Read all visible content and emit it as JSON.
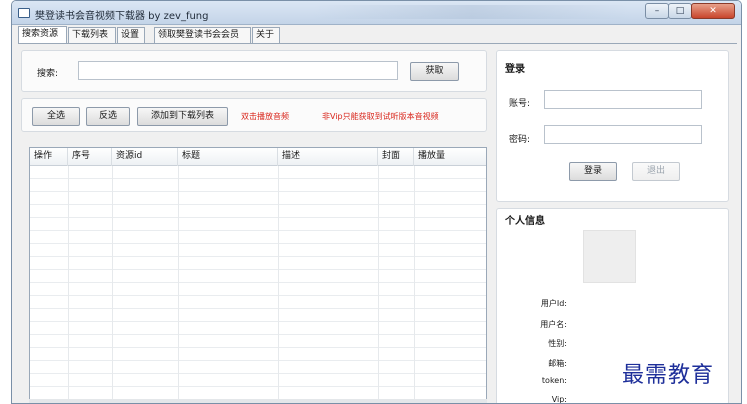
{
  "window": {
    "title": "樊登读书会音视频下载器 by zev_fung",
    "controls": {
      "minimize": "–",
      "maximize": "□",
      "close": "✕"
    }
  },
  "tabs": [
    {
      "label": "搜索资源",
      "active": true
    },
    {
      "label": "下载列表",
      "active": false
    },
    {
      "label": "设置",
      "active": false
    },
    {
      "label": "领取樊登读书会会员",
      "active": false
    },
    {
      "label": "关于",
      "active": false
    }
  ],
  "search": {
    "label": "搜索:",
    "value": "",
    "fetch_button": "获取"
  },
  "actions": {
    "select_all": "全选",
    "invert": "反选",
    "add_to_list": "添加到下载列表",
    "hint_play": "双击播放音频",
    "hint_vip": "非Vip只能获取到试听版本音视频"
  },
  "table": {
    "columns": [
      "操作",
      "序号",
      "资源id",
      "标题",
      "描述",
      "封面",
      "播放量"
    ],
    "rows": []
  },
  "login": {
    "title": "登录",
    "account_label": "账号:",
    "account_value": "",
    "password_label": "密码:",
    "password_value": "",
    "login_button": "登录",
    "logout_button": "退出"
  },
  "profile": {
    "title": "个人信息",
    "fields": [
      {
        "label": "用户Id:",
        "value": ""
      },
      {
        "label": "用户名:",
        "value": ""
      },
      {
        "label": "性别:",
        "value": ""
      },
      {
        "label": "邮箱:",
        "value": ""
      },
      {
        "label": "token:",
        "value": ""
      },
      {
        "label": "Vip:",
        "value": ""
      }
    ]
  },
  "watermark": "最需教育",
  "colors": {
    "hint_red": "#d9261c",
    "watermark_blue": "#1e2f9a",
    "title_bar": "#c3d4e8"
  }
}
